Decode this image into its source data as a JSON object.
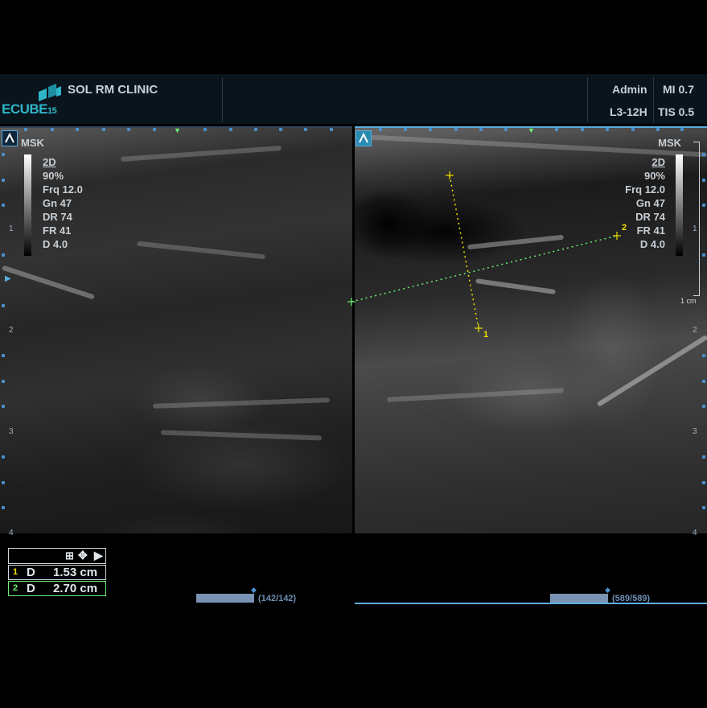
{
  "header": {
    "logo": "ECUBE",
    "logo_num": "15",
    "clinic": "SOL RM CLINIC",
    "user": "Admin",
    "mi": "MI 0.7",
    "probe": "L3-12H",
    "tis": "TIS 0.5"
  },
  "left_panel": {
    "preset": "MSK",
    "params": [
      "2D",
      "90%",
      "Frq 12.0",
      "Gn 47",
      "DR 74",
      "FR 41",
      "D 4.0"
    ],
    "depth_labels": [
      "1",
      "2",
      "3",
      "4"
    ],
    "cine": "(142/142)"
  },
  "right_panel": {
    "preset": "MSK",
    "params": [
      "2D",
      "90%",
      "Frq 12.0",
      "Gn 47",
      "DR 74",
      "FR 41",
      "D 4.0"
    ],
    "depth_labels": [
      "1",
      "2",
      "3",
      "4"
    ],
    "scale": "1 cm",
    "cine": "(589/589)",
    "marker1": "1",
    "marker2": "2"
  },
  "measurements": [
    {
      "id": "1",
      "type": "D",
      "value": "1.53 cm",
      "color": "#f0e000"
    },
    {
      "id": "2",
      "type": "D",
      "value": "2.70 cm",
      "color": "#6cf26c"
    }
  ],
  "colors": {
    "accent": "#2fb6c8",
    "tick": "#4a8fd0",
    "caliper1": "#f0e000",
    "caliper2": "#6cf26c"
  },
  "icons": [
    "grid-icon",
    "move-icon",
    "play-icon"
  ]
}
